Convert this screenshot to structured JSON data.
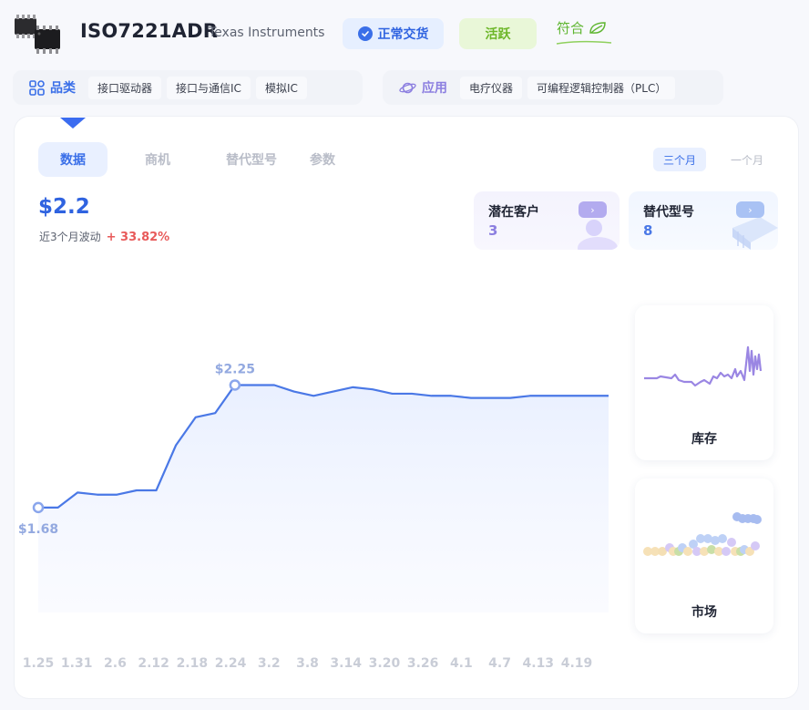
{
  "header": {
    "part_number": "ISO7221ADR",
    "manufacturer": "Texas Instruments",
    "status": "正常交货",
    "activity": "活跃",
    "compliance": "符合"
  },
  "category": {
    "title": "品类",
    "tags": [
      "接口驱动器",
      "接口与通信IC",
      "模拟IC"
    ]
  },
  "application": {
    "title": "应用",
    "tags": [
      "电疗仪器",
      "可编程逻辑控制器（PLC）"
    ]
  },
  "tabs": [
    "数据",
    "商机",
    "替代型号",
    "参数"
  ],
  "range": {
    "three_months": "三个月",
    "one_month": "一个月"
  },
  "summary": {
    "price": "$2.2",
    "fluct_label": "近3个月波动",
    "fluct_value": "+ 33.82%"
  },
  "stats": [
    {
      "label": "潜在客户",
      "value": "3"
    },
    {
      "label": "替代型号",
      "value": "8"
    }
  ],
  "side": {
    "inventory": "库存",
    "market": "市场"
  },
  "colors": {
    "accent": "#3a6fe8",
    "up": "#e85a5a",
    "active": "#6cb628",
    "purple": "#8c7fe0"
  },
  "chart_data": {
    "type": "line",
    "x": [
      "1.25",
      "1.31",
      "2.6",
      "2.12",
      "2.18",
      "2.24",
      "3.2",
      "3.8",
      "3.14",
      "3.20",
      "3.26",
      "4.1",
      "4.7",
      "4.13",
      "4.19"
    ],
    "series": [
      {
        "values": [
          1.68,
          1.68,
          1.75,
          1.74,
          1.74,
          1.76,
          1.76,
          1.97,
          2.1,
          2.12,
          2.25,
          2.25,
          2.25,
          2.22,
          2.2,
          2.22,
          2.24,
          2.23,
          2.21,
          2.21,
          2.2,
          2.2,
          2.19,
          2.19,
          2.19,
          2.2,
          2.2,
          2.2,
          2.2,
          2.2
        ]
      }
    ],
    "min_label": "$1.68",
    "max_label": "$2.25",
    "ylim": [
      1.2,
      2.6
    ]
  }
}
